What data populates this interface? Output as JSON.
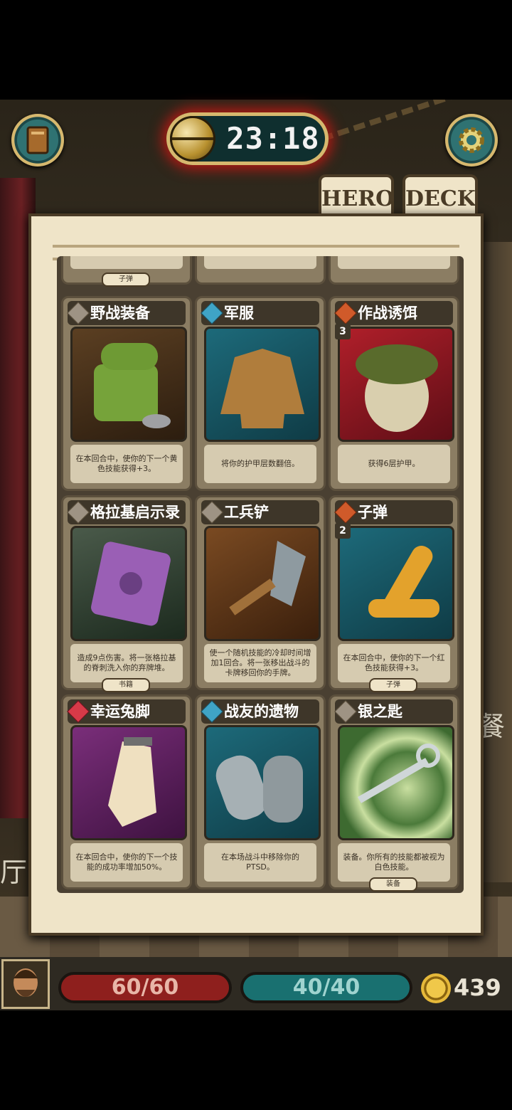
{
  "timer": {
    "time": "23:18"
  },
  "tabs": {
    "hero": "HERO",
    "deck": "DECK"
  },
  "background_labels": {
    "left": "厅",
    "right": "餐"
  },
  "partial_tags": [
    "子弹"
  ],
  "cards": [
    {
      "title": "野战装备",
      "type": "gray",
      "level": "",
      "description": "在本回合中，使你的下一个黄色技能获得+3。",
      "tag": "",
      "art": "green-backpack"
    },
    {
      "title": "军服",
      "type": "blue",
      "level": "",
      "description": "将你的护甲层数翻倍。",
      "tag": "",
      "art": "military-jacket"
    },
    {
      "title": "作战诱饵",
      "type": "orange",
      "level": "3",
      "description": "获得6层护甲。",
      "tag": "",
      "art": "soldier-decoy"
    },
    {
      "title": "格拉基启示录",
      "type": "gray",
      "level": "",
      "description": "造成9点伤害。将一张格拉基的脊刺洗入你的弃牌堆。",
      "tag": "书籍",
      "art": "purple-book"
    },
    {
      "title": "工兵铲",
      "type": "gray",
      "level": "",
      "description": "使一个随机技能的冷却时间增加1回合。将一张移出战斗的卡牌移回你的手牌。",
      "tag": "",
      "art": "shovel"
    },
    {
      "title": "子弹",
      "type": "orange",
      "level": "2",
      "description": "在本回合中，使你的下一个红色技能获得+3。",
      "tag": "子弹",
      "art": "bullets"
    },
    {
      "title": "幸运兔脚",
      "type": "heart",
      "level": "",
      "description": "在本回合中，使你的下一个技能的成功率增加50%。",
      "tag": "",
      "art": "rabbit-foot"
    },
    {
      "title": "战友的遗物",
      "type": "blue",
      "level": "",
      "description": "在本场战斗中移除你的PTSD。",
      "tag": "",
      "art": "dog-tags"
    },
    {
      "title": "银之匙",
      "type": "gray",
      "level": "",
      "description": "装备。你所有的技能都被视为白色技能。",
      "tag": "装备",
      "art": "silver-key"
    }
  ],
  "stats": {
    "hp": "60/60",
    "sanity": "40/40",
    "gold": "439"
  },
  "colors": {
    "hp_bar": "#8e1f1d",
    "sanity_bar": "#197070",
    "panel": "#efe4c8",
    "timer_glow": "#b01a14"
  }
}
